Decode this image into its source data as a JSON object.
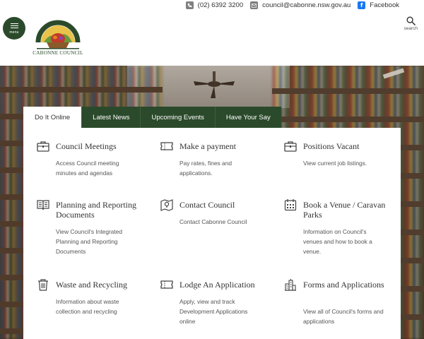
{
  "contact": {
    "phone": "(02) 6392 3200",
    "email": "council@cabonne.nsw.gov.au",
    "facebook": "Facebook"
  },
  "header": {
    "menu_label": "menu",
    "logo_name": "CABONNE COUNCIL",
    "search_label": "search"
  },
  "tabs": [
    {
      "label": "Do It Online",
      "active": true
    },
    {
      "label": "Latest News",
      "active": false
    },
    {
      "label": "Upcoming Events",
      "active": false
    },
    {
      "label": "Have Your Say",
      "active": false
    }
  ],
  "services": [
    {
      "icon": "briefcase-icon",
      "title": "Council Meetings",
      "desc": "Access Council meeting minutes and agendas"
    },
    {
      "icon": "ticket-icon",
      "title": "Make a payment",
      "desc": "Pay rates, fines and applications."
    },
    {
      "icon": "briefcase-icon",
      "title": "Positions Vacant",
      "desc": "View current job listings."
    },
    {
      "icon": "open-book-icon",
      "title": "Planning and Reporting Documents",
      "desc": "View Council's Integrated Planning and Reporting Documents"
    },
    {
      "icon": "map-pin-icon",
      "title": "Contact Council",
      "desc": "Contact Cabonne Council"
    },
    {
      "icon": "calendar-icon",
      "title": "Book a Venue / Caravan Parks",
      "desc": "Information on Council's venues and how to book a venue."
    },
    {
      "icon": "trash-icon",
      "title": "Waste and Recycling",
      "desc": "Information about waste collection and recycling"
    },
    {
      "icon": "ticket-icon",
      "title": "Lodge An Application",
      "desc": "Apply, view and track Development Applications online"
    },
    {
      "icon": "buildings-icon",
      "title": "Forms and Applications",
      "desc": "View all of Council's forms and applications"
    }
  ],
  "colors": {
    "brand_green": "#2b4a2b",
    "panel_bg": "#ffffff",
    "text": "#333333"
  }
}
